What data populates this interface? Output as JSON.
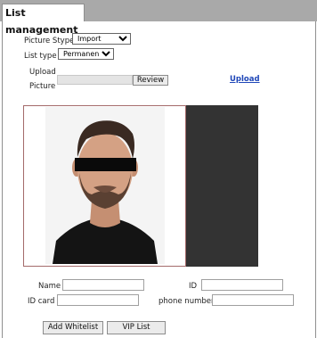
{
  "tab": {
    "title": "List management"
  },
  "form": {
    "picture_type_label": "Picture Stype",
    "picture_type_value": "Import",
    "list_type_label": "List type",
    "list_type_value": "Permanent lis",
    "upload_label_line1": "Upload",
    "upload_label_line2": "Picture",
    "review_label": "Review",
    "upload_link": "Upload"
  },
  "fields": {
    "name_label": "Name",
    "id_label": "ID",
    "id_card_label": "ID card",
    "phone_label": "phone number"
  },
  "buttons": {
    "add_whitelist": "Add Whitelist",
    "vip_list": "VIP List"
  },
  "colors": {
    "tab_bar": "#a9a9a9",
    "dark_panel": "#333333",
    "link": "#1f47b8"
  }
}
